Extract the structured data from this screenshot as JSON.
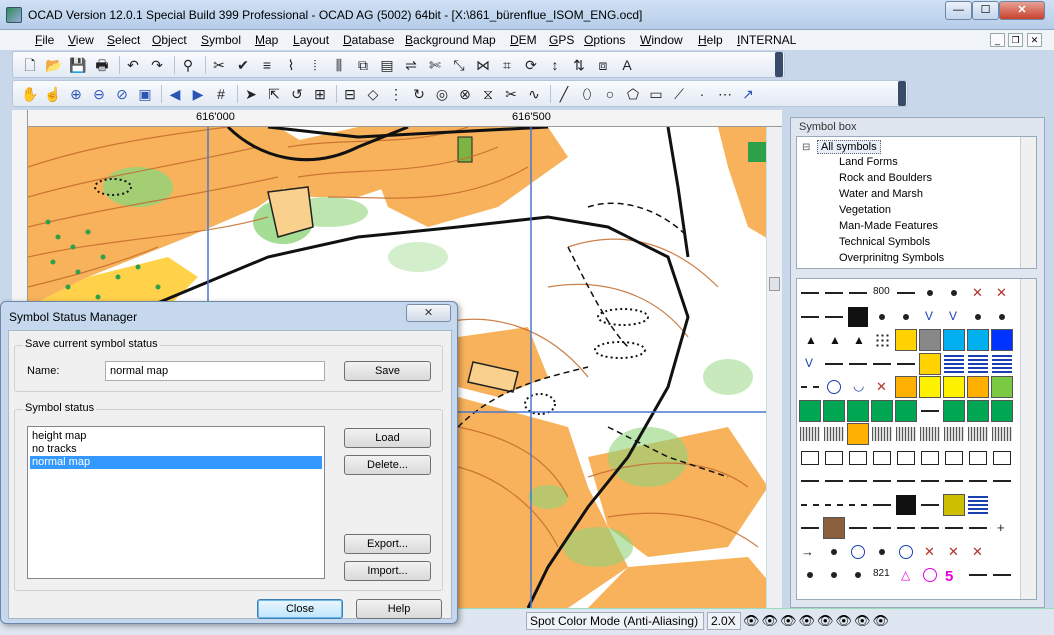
{
  "window": {
    "title": "OCAD Version 12.0.1  Special Build 399  Professional - OCAD AG (5002) 64bit - [X:\\861_bürenflue_ISOM_ENG.ocd]",
    "controls": {
      "minimize": "—",
      "maximize": "☐",
      "close": "✕"
    }
  },
  "menu": {
    "items": [
      "File",
      "View",
      "Select",
      "Object",
      "Symbol",
      "Map",
      "Layout",
      "Database",
      "Background Map",
      "DEM",
      "GPS",
      "Options",
      "Window",
      "Help",
      "INTERNAL"
    ],
    "mdi": {
      "minimize": "_",
      "restore": "❐",
      "close": "✕"
    }
  },
  "toolbar1": {
    "icons": [
      "new-file-icon",
      "open-file-icon",
      "save-icon",
      "print-icon",
      "undo-icon",
      "redo-icon",
      "binoculars-icon",
      "cut-icon",
      "check-icon",
      "align-icon",
      "smooth-icon",
      "dash-points-icon",
      "parallel-icon",
      "join-icon",
      "fill-icon",
      "convert-icon",
      "cut-object-icon",
      "reshape-icon",
      "merge-icon",
      "crop-icon",
      "rotate-icon",
      "move-icon",
      "reverse-icon",
      "duplicate-icon",
      "text-icon"
    ],
    "glyphs": [
      "🗋",
      "📂",
      "💾",
      "🖶",
      "↶",
      "↷",
      "⚲",
      "✂",
      "✔",
      "≡",
      "⌇",
      "⦙",
      "⫼",
      "⧉",
      "▤",
      "⇌",
      "✄",
      "⤡",
      "⋈",
      "⌗",
      "⟳",
      "↕",
      "⇅",
      "⧈",
      "A"
    ]
  },
  "toolbar2": {
    "icons": [
      "hand-icon",
      "zoom-hand-icon",
      "zoom-in-icon",
      "zoom-out-icon",
      "zoom-prev-icon",
      "zoom-page-icon",
      "back-arrow-icon",
      "forward-arrow-icon",
      "grid-icon",
      "select-object-icon",
      "edit-point-icon",
      "curve-mode-icon",
      "add-vertex-icon",
      "remove-vertex-icon",
      "corner-icon",
      "dash-icon",
      "rotate-pattern-icon",
      "circle-cut-icon",
      "cut-hole-icon",
      "merge-area-icon",
      "scissors-icon",
      "freehand-icon",
      "line-mode-icon",
      "ellipse-icon",
      "circle-icon",
      "polygon-icon",
      "rectangle-icon",
      "straight-icon",
      "number-icon",
      "dots-icon",
      "arrow-icon"
    ],
    "glyphs": [
      "✋",
      "☝",
      "⊕",
      "⊖",
      "⊘",
      "▣",
      "◀",
      "▶",
      "#",
      "➤",
      "⇱",
      "↺",
      "⊞",
      "⊟",
      "◇",
      "⋮",
      "↻",
      "◎",
      "⊗",
      "⧖",
      "✂",
      "∿",
      "╱",
      "⬯",
      "○",
      "⬠",
      "▭",
      "⟋",
      "·",
      "⋯",
      "↗"
    ]
  },
  "rulers": {
    "x_labels": [
      "616'000",
      "616'500"
    ]
  },
  "symbol_box": {
    "title": "Symbol box",
    "root": "All symbols",
    "categories": [
      "Land Forms",
      "Rock and Boulders",
      "Water and Marsh",
      "Vegetation",
      "Man-Made Features",
      "Technical Symbols",
      "Overprinitng Symbols"
    ],
    "grid_text": [
      "800",
      "821",
      "5"
    ]
  },
  "status": {
    "mode": "Spot Color Mode (Anti-Aliasing)",
    "zoom": "2.0X",
    "layer_icons": "👁👁👁👁👁👁👁👁"
  },
  "dialog": {
    "title": "Symbol Status Manager",
    "close": "✕",
    "save_group": "Save current symbol status",
    "name_label": "Name:",
    "name_value": "normal map",
    "save_button": "Save",
    "status_group": "Symbol status",
    "list": [
      "height map",
      "no tracks",
      "normal map"
    ],
    "selected_index": 2,
    "load_button": "Load",
    "delete_button": "Delete...",
    "export_button": "Export...",
    "import_button": "Import...",
    "close_button": "Close",
    "help_button": "Help"
  },
  "colors": {
    "map_orange": "#f7b25b",
    "map_yellow": "#ffd24a",
    "map_green": "#8fd47a",
    "contour_brown": "#c46a2c",
    "path_black": "#111111",
    "selection_blue": "#3399ff"
  }
}
